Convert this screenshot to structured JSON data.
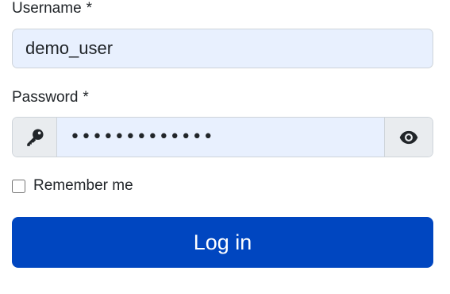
{
  "form": {
    "username": {
      "label": "Username",
      "required_mark": "*",
      "value": "demo_user"
    },
    "password": {
      "label": "Password",
      "required_mark": "*",
      "masked_value": "•••••••••••••",
      "left_icon": "key-icon",
      "toggle_icon": "eye-icon"
    },
    "remember": {
      "label": "Remember me",
      "checked": false
    },
    "submit_label": "Log in"
  },
  "colors": {
    "accent": "#0046c0",
    "input_fill": "#e8f0fe",
    "addon_fill": "#e9ecef",
    "border": "#ced4da",
    "text": "#212529"
  }
}
